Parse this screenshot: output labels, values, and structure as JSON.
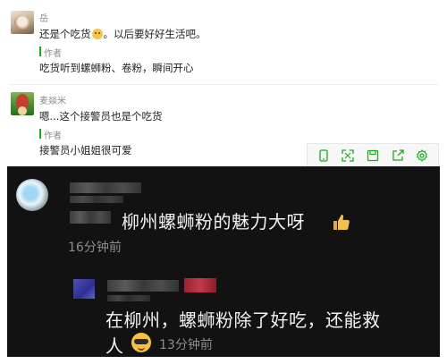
{
  "comments": [
    {
      "user": "岳",
      "text_before_emoji": "还是个吃货",
      "emoji": "grinning-face-emoji",
      "text_after_emoji": "。以后要好好生活吧。",
      "author_tag": "作者",
      "author_reply": "吃货听到螺蛳粉、卷粉，瞬间开心"
    },
    {
      "user": "麦燚米",
      "text": "嗯...这个接警员也是个吃货",
      "author_tag": "作者",
      "author_reply": "接警员小姐姐很可爱"
    }
  ],
  "toolbar": {
    "icons": [
      "phone-icon",
      "expand-icon",
      "save-icon",
      "share-icon",
      "settings-icon"
    ]
  },
  "embedded_screenshot": {
    "comment1": {
      "text": "柳州螺蛳粉的魅力大呀",
      "emoji": "thumbs-up-emoji",
      "time": "16分钟前"
    },
    "comment2": {
      "text_line1": "在柳州，螺蛳粉除了好吃，还能救",
      "text_line2": "人",
      "emoji": "sunglasses-emoji",
      "time": "13分钟前"
    }
  },
  "colors": {
    "author_accent": "#1aad19",
    "name_gray": "#8a8a8a",
    "photo_bg": "#121212"
  }
}
